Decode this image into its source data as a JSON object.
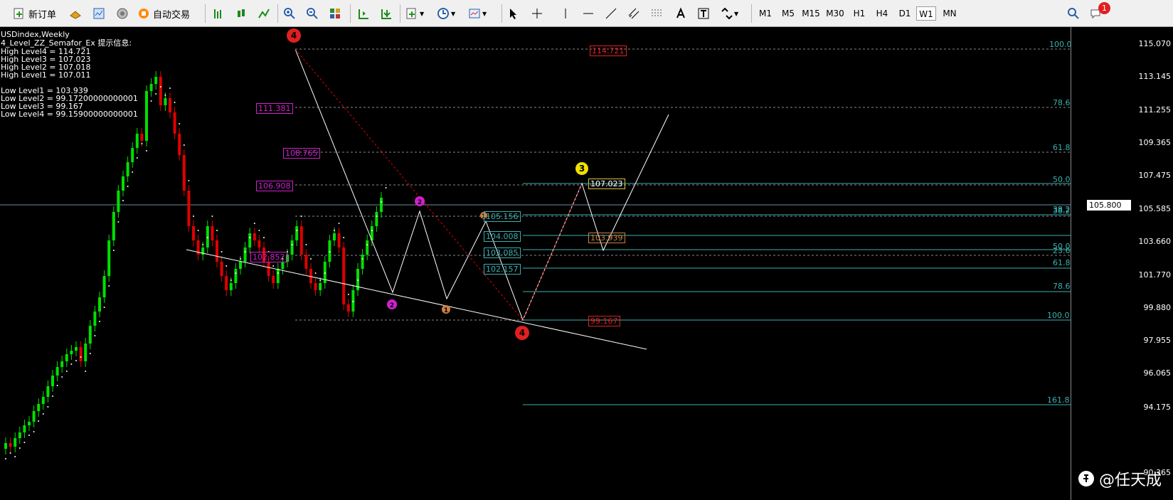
{
  "toolbar": {
    "new_order": "新订单",
    "auto_trading": "自动交易",
    "timeframes": [
      "M1",
      "M5",
      "M15",
      "M30",
      "H1",
      "H4",
      "D1",
      "W1",
      "MN"
    ],
    "active_timeframe": "W1",
    "notification_count": "1"
  },
  "chart": {
    "symbol": "USDindex,Weekly",
    "indicator_title": "4_Level_ZZ_Semafor_Ex 提示信息:",
    "info_lines": [
      "High Level4 = 114.721",
      "High Level3 = 107.023",
      "High Level2 = 107.018",
      "High Level1 = 107.011",
      "",
      "Low Level1 = 103.939",
      "Low Level2 = 99.17200000000001",
      "Low Level3 = 99.167",
      "Low Level4 = 99.15900000000001"
    ],
    "price_scale": [
      "115.070",
      "113.145",
      "111.255",
      "109.365",
      "107.475",
      "105.585",
      "103.660",
      "101.770",
      "99.880",
      "97.955",
      "96.065",
      "94.175",
      "90.365"
    ],
    "current_price": "105.800",
    "fibo_levels": [
      "100.0",
      "78.6",
      "61.8",
      "50.0",
      "38.2",
      "38.2",
      "50.0",
      "23.6",
      "61.8",
      "78.6",
      "100.0",
      "161.8"
    ],
    "level_boxes": [
      "114.721",
      "111.381",
      "108.765",
      "106.908",
      "102.852",
      "105.156",
      "104.008",
      "103.085",
      "102.157",
      "107.023",
      "103.939",
      "99.167"
    ],
    "semafor_labels": [
      "4",
      "2",
      "2",
      "1",
      "1",
      "3",
      "4"
    ],
    "colors": {
      "bull": "#00e000",
      "bear": "#e00000",
      "fibo": "#3bb0b0",
      "magenta": "#d020d0"
    }
  },
  "watermark": "@任天成"
}
